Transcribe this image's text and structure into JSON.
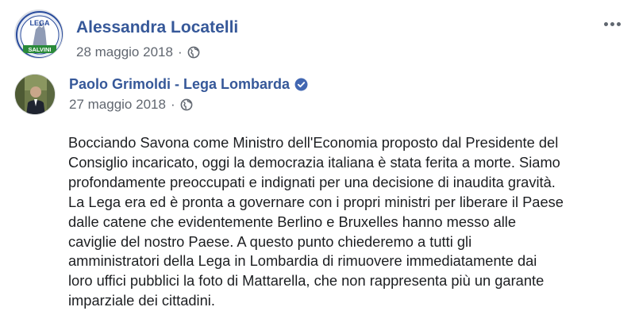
{
  "shared_by": {
    "name": "Alessandra Locatelli",
    "date": "28 maggio 2018",
    "separator": "·",
    "audience_icon": "globe-icon",
    "avatar_text_top": "LEGA",
    "avatar_text_bottom": "SALVINI"
  },
  "more_options_icon": "more-options-icon",
  "original_post": {
    "author": "Paolo Grimoldi - Lega Lombarda",
    "verified_icon": "verified-badge-icon",
    "date": "27 maggio 2018",
    "separator": "·",
    "audience_icon": "globe-icon",
    "text_lines": [
      "Bocciando Savona come Ministro dell'Economia proposto dal Presidente del",
      "Consiglio incaricato, oggi la democrazia italiana è stata ferita a morte. Siamo",
      "profondamente preoccupati e indignati per una decisione di inaudita gravità.",
      "La Lega era ed è pronta a governare con i propri ministri per liberare il Paese",
      "dalle catene che evidentemente Berlino e Bruxelles hanno messo alle",
      "caviglie del nostro Paese. A questo punto chiederemo a tutti gli",
      "amministratori della Lega in Lombardia di rimuovere immediatamente dai",
      "loro uffici pubblici la foto di Mattarella, che non rappresenta più un garante",
      "imparziale dei cittadini."
    ]
  },
  "colors": {
    "link_blue": "#365899",
    "meta_gray": "#616770",
    "text": "#1c1e21",
    "verified_blue": "#4267b2"
  }
}
